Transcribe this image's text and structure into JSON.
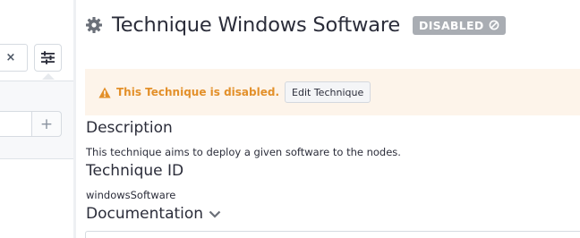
{
  "sidebar": {
    "filter_clear_label": "×",
    "add_label": "+",
    "icons": {
      "settings": "sliders-icon",
      "clear": "close-icon",
      "add": "plus-icon"
    }
  },
  "header": {
    "title": "Technique Windows Software",
    "status_badge": "DISABLED",
    "icons": {
      "title": "gear-icon",
      "badge": "ban-icon"
    }
  },
  "alert": {
    "message": "This Technique is disabled.",
    "edit_button": "Edit Technique",
    "icon": "warning-icon"
  },
  "sections": {
    "description": {
      "title": "Description",
      "text": "This technique aims to deploy a given software to the nodes."
    },
    "technique_id": {
      "title": "Technique ID",
      "value": "windowsSoftware"
    },
    "documentation": {
      "title": "Documentation",
      "icon": "chevron-down-icon"
    }
  },
  "colors": {
    "badge_bg": "#a9adb3",
    "alert_bg": "#fdf4ea",
    "alert_text": "#e3902a",
    "text": "#2b2d3a"
  }
}
